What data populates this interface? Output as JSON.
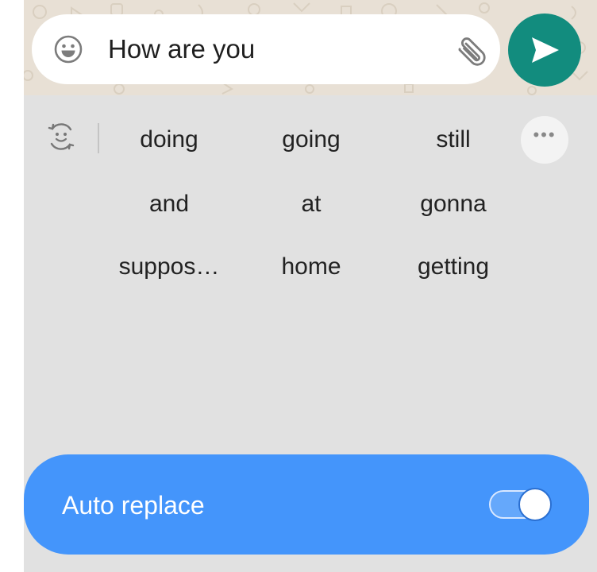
{
  "compose": {
    "message_text": "How are you",
    "icons": {
      "emoji": "emoji-icon",
      "attach": "paperclip-icon",
      "send": "send-icon"
    }
  },
  "suggestions": {
    "icons": {
      "reset": "emoji-refresh-icon",
      "more": "more-icon"
    },
    "more_label": "•••",
    "rows": [
      [
        "doing",
        "going",
        "still"
      ],
      [
        "and",
        "at",
        "gonna"
      ],
      [
        "suppos…",
        "home",
        "getting"
      ]
    ]
  },
  "auto_replace": {
    "label": "Auto replace",
    "enabled": true
  },
  "colors": {
    "send_button": "#128c7e",
    "panel_bg": "#e1e1e1",
    "auto_replace_bar": "#4495fb",
    "chat_bg": "#e8e0d5"
  }
}
